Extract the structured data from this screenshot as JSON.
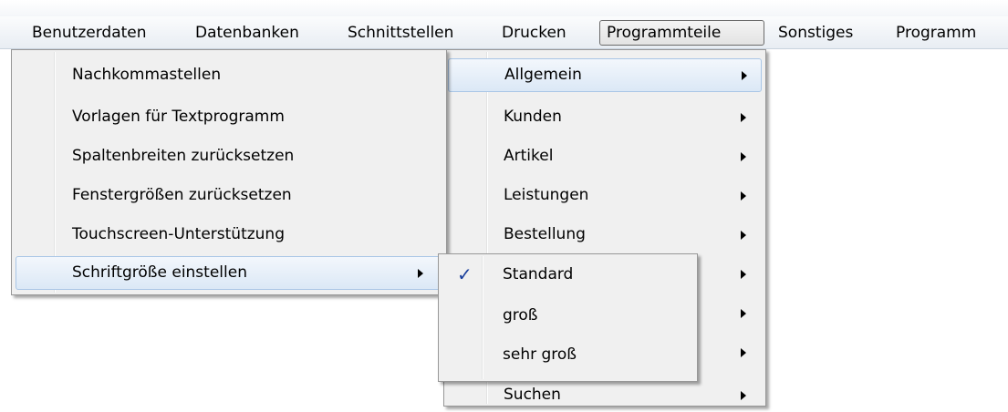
{
  "menubar": {
    "items": [
      {
        "label": "Benutzerdaten"
      },
      {
        "label": "Datenbanken"
      },
      {
        "label": "Schnittstellen"
      },
      {
        "label": "Drucken"
      },
      {
        "label": "Programmteile"
      },
      {
        "label": "Sonstiges"
      },
      {
        "label": "Programm"
      }
    ],
    "active_index": 4
  },
  "programmteile_menu": {
    "items": [
      {
        "label": "Allgemein"
      },
      {
        "label": "Kunden"
      },
      {
        "label": "Artikel"
      },
      {
        "label": "Leistungen"
      },
      {
        "label": "Bestellung"
      },
      {
        "label": ""
      },
      {
        "label": ""
      },
      {
        "label": ""
      },
      {
        "label": "Suchen"
      }
    ]
  },
  "allgemein_menu": {
    "items": [
      {
        "label": "Nachkommastellen"
      },
      {
        "label": "Vorlagen für Textprogramm"
      },
      {
        "label": "Spaltenbreiten zurücksetzen"
      },
      {
        "label": "Fenstergrößen zurücksetzen"
      },
      {
        "label": "Touchscreen-Unterstützung"
      },
      {
        "label": "Schriftgröße einstellen"
      }
    ]
  },
  "schriftgroesse_menu": {
    "items": [
      {
        "label": "Standard",
        "checked": true
      },
      {
        "label": "groß",
        "checked": false
      },
      {
        "label": "sehr groß",
        "checked": false
      }
    ],
    "check_glyph": "✓"
  },
  "colors": {
    "highlight": "#dbe8f6",
    "check": "#1a3f9c",
    "menu_bg": "#f0f0f0"
  }
}
